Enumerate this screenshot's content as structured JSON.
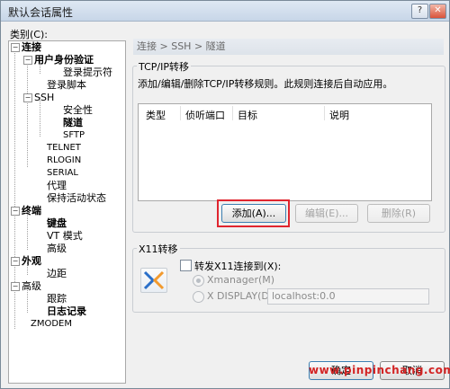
{
  "window": {
    "title": "默认会话属性",
    "help_icon": "?",
    "close_icon": "✕"
  },
  "category_label": "类别(C):",
  "tree": {
    "items": [
      {
        "label": "连接",
        "bold": true
      },
      {
        "label": "用户身份验证",
        "bold": true
      },
      {
        "label": "登录提示符",
        "bold": false
      },
      {
        "label": "登录脚本",
        "bold": false
      },
      {
        "label": "SSH",
        "bold": false
      },
      {
        "label": "安全性",
        "bold": false
      },
      {
        "label": "隧道",
        "bold": true
      },
      {
        "label": "SFTP",
        "bold": false
      },
      {
        "label": "TELNET",
        "bold": false
      },
      {
        "label": "RLOGIN",
        "bold": false
      },
      {
        "label": "SERIAL",
        "bold": false
      },
      {
        "label": "代理",
        "bold": false
      },
      {
        "label": "保持活动状态",
        "bold": false
      },
      {
        "label": "终端",
        "bold": true
      },
      {
        "label": "键盘",
        "bold": true
      },
      {
        "label": "VT 模式",
        "bold": false
      },
      {
        "label": "高级",
        "bold": false
      },
      {
        "label": "外观",
        "bold": true
      },
      {
        "label": "边距",
        "bold": false
      },
      {
        "label": "高级",
        "bold": false
      },
      {
        "label": "跟踪",
        "bold": false
      },
      {
        "label": "日志记录",
        "bold": true
      },
      {
        "label": "ZMODEM",
        "bold": false
      }
    ]
  },
  "breadcrumb": "连接 > SSH > 隧道",
  "tcpip": {
    "group_title": "TCP/IP转移",
    "description": "添加/编辑/删除TCP/IP转移规则。此规则连接后自动应用。",
    "columns": [
      "类型",
      "侦听端口",
      "目标",
      "说明"
    ],
    "add_label": "添加(A)...",
    "edit_label": "编辑(E)...",
    "delete_label": "删除(R)"
  },
  "x11": {
    "group_title": "X11转移",
    "forward_label": "转发X11连接到(X):",
    "xmanager_label": "Xmanager(M)",
    "xdisplay_label": "X DISPLAY(D):",
    "display_value": "localhost:0.0"
  },
  "footer": {
    "ok_label": "确定",
    "cancel_label": "取消",
    "watermark": "www.pinpinchang.com"
  }
}
